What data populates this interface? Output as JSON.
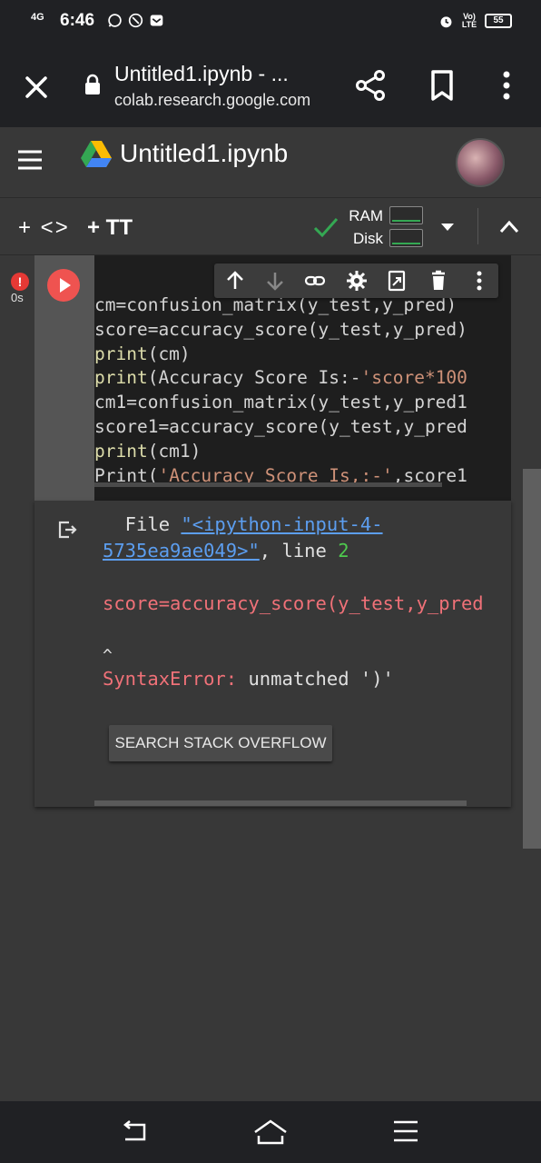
{
  "status_bar": {
    "network": "4G",
    "time": "6:46",
    "lte_label": "Vo) LTE",
    "battery": "55"
  },
  "browser": {
    "page_title": "Untitled1.ipynb - ...",
    "host": "colab.research.google.com"
  },
  "colab": {
    "notebook_title": "Untitled1.ipynb"
  },
  "toolbar": {
    "add_code_label": "+ <>",
    "add_text_label": "+ TT",
    "ram_label": "RAM",
    "disk_label": "Disk"
  },
  "cell": {
    "status_badge": "!",
    "exec_time": "0s",
    "code_lines": [
      {
        "pre": "cm=confusion_matrix(y_test,y_pred)",
        "str": "",
        "post": ""
      },
      {
        "pre": "score=accuracy_score(y_test,y_pred)",
        "str": "",
        "post": ""
      },
      {
        "kw": "print",
        "pre": "(cm)",
        "str": "",
        "post": ""
      },
      {
        "kw": "print",
        "pre": "(Accuracy Score Is:-",
        "str": "'score*100",
        "post": ""
      },
      {
        "pre": "cm1=confusion_matrix(y_test,y_pred1",
        "str": "",
        "post": ""
      },
      {
        "pre": "score1=accuracy_score(y_test,y_pred",
        "str": "",
        "post": ""
      },
      {
        "kw": "print",
        "pre": "(cm1)",
        "str": "",
        "post": ""
      },
      {
        "pre": "Print(",
        "str": "'Accuracy Score Is,:-'",
        "post": ",score1"
      }
    ]
  },
  "output": {
    "file_prefix": "  File ",
    "file_link_1": "\"<ipython-input-4-",
    "file_link_2": "5735ea9ae049>\"",
    "line_label": ", line ",
    "line_number": "2",
    "error_line": "score=accuracy_score(y_test,y_pred",
    "caret": "^",
    "error_type": "SyntaxError:",
    "error_message": " unmatched ')'",
    "search_button": "SEARCH STACK OVERFLOW"
  }
}
